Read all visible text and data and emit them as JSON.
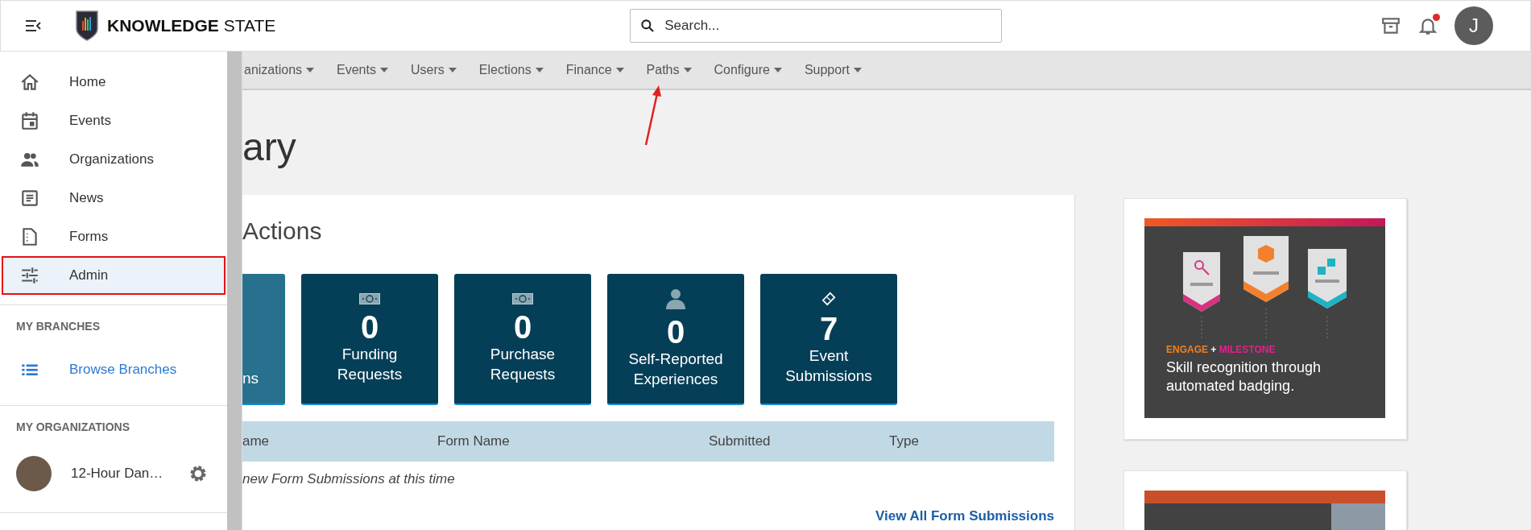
{
  "header": {
    "brand": "**KNOWLEDGE** STATE",
    "search": {
      "placeholder": "Search..."
    },
    "notification": true,
    "avatar": "J"
  },
  "sidebar": {
    "items": [
      {
        "label": "Home",
        "selected": false,
        "highlighted": false
      },
      {
        "label": "Events",
        "selected": false,
        "highlighted": false
      },
      {
        "label": "Organizations",
        "selected": false,
        "highlighted": false
      },
      {
        "label": "News",
        "selected": false,
        "highlighted": false
      },
      {
        "label": "Forms",
        "selected": false,
        "highlighted": false
      },
      {
        "label": "Admin",
        "selected": true,
        "highlighted": true
      }
    ],
    "branches": {
      "heading": "MY BRANCHES",
      "link": "Browse Branches"
    },
    "organizations": {
      "heading": "MY ORGANIZATIONS",
      "items": [
        {
          "name": "12-Hour Dan…"
        }
      ]
    }
  },
  "nav": [
    {
      "label": "anizations",
      "annotated": false
    },
    {
      "label": "Events",
      "annotated": false
    },
    {
      "label": "Users",
      "annotated": false
    },
    {
      "label": "Elections",
      "annotated": false
    },
    {
      "label": "Finance",
      "annotated": false
    },
    {
      "label": "Paths",
      "annotated": true
    },
    {
      "label": "Configure",
      "annotated": false
    },
    {
      "label": "Support",
      "annotated": false
    }
  ],
  "page_title": "ary",
  "actions": {
    "heading": "Actions",
    "tiles": [
      {
        "kind": "partial",
        "label": "ns",
        "selected": true
      },
      {
        "kind": "money",
        "count": "0",
        "label": "Funding Requests",
        "selected": false
      },
      {
        "kind": "money",
        "count": "0",
        "label": "Purchase Requests",
        "selected": false
      },
      {
        "kind": "person",
        "count": "0",
        "label": "Self-Reported Experiences",
        "selected": false
      },
      {
        "kind": "ticket",
        "count": "7",
        "label": "Event Submissions",
        "selected": false
      }
    ]
  },
  "table": {
    "columns": [
      "ame",
      "Form Name",
      "Submitted",
      "Type"
    ],
    "empty": "new Form Submissions at this time",
    "link": "View All Form Submissions"
  },
  "promo": {
    "tagline_1": "ENGAGE",
    "separator": "+",
    "tagline_2": "MILESTONE",
    "text": "Skill recognition through automated badging."
  }
}
